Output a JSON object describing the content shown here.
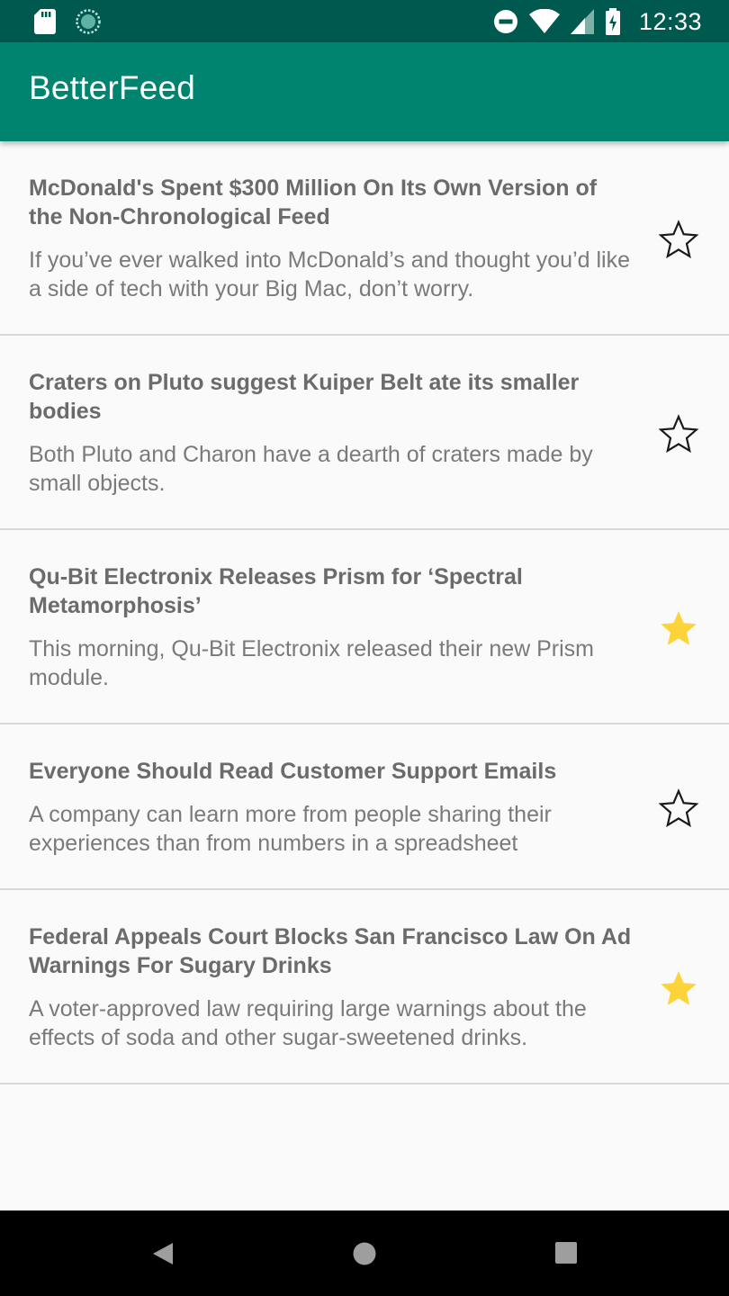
{
  "status_bar": {
    "time": "12:33",
    "icons": [
      "sd-card-icon",
      "sync-icon",
      "do-not-disturb-icon",
      "wifi-icon",
      "signal-icon",
      "battery-charging-icon"
    ]
  },
  "app_bar": {
    "title": "BetterFeed"
  },
  "colors": {
    "status_bar": "#00594f",
    "app_bar": "#00836f",
    "star_filled": "#fdd33a",
    "title_text": "#6b6b6b",
    "desc_text": "#7a7a7a"
  },
  "feed": {
    "items": [
      {
        "title": "McDonald's Spent $300 Million On Its Own Version of the Non-Chronological Feed",
        "description": "If you’ve ever walked into McDonald’s and thought you’d like a side of tech with your Big Mac, don’t worry.",
        "starred": false
      },
      {
        "title": "Craters on Pluto suggest Kuiper Belt ate its smaller bodies",
        "description": "Both Pluto and Charon have a dearth of craters made by small objects.",
        "starred": false
      },
      {
        "title": "Qu-Bit Electronix Releases Prism for ‘Spectral Metamorphosis’",
        "description": "This morning, Qu-Bit Electronix released their new Prism module.",
        "starred": true
      },
      {
        "title": "Everyone Should Read Customer Support Emails",
        "description": "A company can learn more from people sharing their experiences than from numbers in a spreadsheet",
        "starred": false
      },
      {
        "title": "Federal Appeals Court Blocks San Francisco Law On Ad Warnings For Sugary Drinks",
        "description": "A voter-approved law requiring large warnings about the effects of soda and other sugar-sweetened drinks.",
        "starred": true
      }
    ]
  },
  "nav_bar": {
    "buttons": [
      "back-icon",
      "home-icon",
      "recents-icon"
    ]
  }
}
